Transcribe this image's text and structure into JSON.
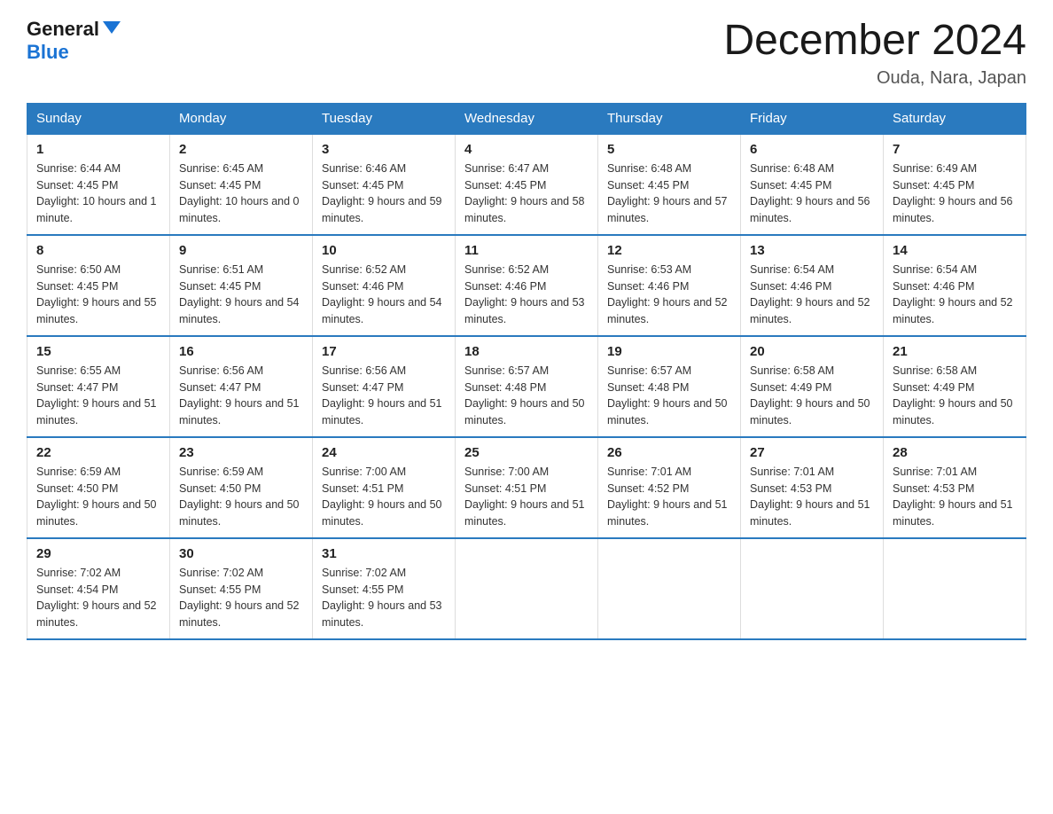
{
  "header": {
    "logo_general": "General",
    "logo_blue": "Blue",
    "month_title": "December 2024",
    "subtitle": "Ouda, Nara, Japan"
  },
  "days_of_week": [
    "Sunday",
    "Monday",
    "Tuesday",
    "Wednesday",
    "Thursday",
    "Friday",
    "Saturday"
  ],
  "weeks": [
    [
      {
        "day": "1",
        "sunrise": "6:44 AM",
        "sunset": "4:45 PM",
        "daylight": "10 hours and 1 minute."
      },
      {
        "day": "2",
        "sunrise": "6:45 AM",
        "sunset": "4:45 PM",
        "daylight": "10 hours and 0 minutes."
      },
      {
        "day": "3",
        "sunrise": "6:46 AM",
        "sunset": "4:45 PM",
        "daylight": "9 hours and 59 minutes."
      },
      {
        "day": "4",
        "sunrise": "6:47 AM",
        "sunset": "4:45 PM",
        "daylight": "9 hours and 58 minutes."
      },
      {
        "day": "5",
        "sunrise": "6:48 AM",
        "sunset": "4:45 PM",
        "daylight": "9 hours and 57 minutes."
      },
      {
        "day": "6",
        "sunrise": "6:48 AM",
        "sunset": "4:45 PM",
        "daylight": "9 hours and 56 minutes."
      },
      {
        "day": "7",
        "sunrise": "6:49 AM",
        "sunset": "4:45 PM",
        "daylight": "9 hours and 56 minutes."
      }
    ],
    [
      {
        "day": "8",
        "sunrise": "6:50 AM",
        "sunset": "4:45 PM",
        "daylight": "9 hours and 55 minutes."
      },
      {
        "day": "9",
        "sunrise": "6:51 AM",
        "sunset": "4:45 PM",
        "daylight": "9 hours and 54 minutes."
      },
      {
        "day": "10",
        "sunrise": "6:52 AM",
        "sunset": "4:46 PM",
        "daylight": "9 hours and 54 minutes."
      },
      {
        "day": "11",
        "sunrise": "6:52 AM",
        "sunset": "4:46 PM",
        "daylight": "9 hours and 53 minutes."
      },
      {
        "day": "12",
        "sunrise": "6:53 AM",
        "sunset": "4:46 PM",
        "daylight": "9 hours and 52 minutes."
      },
      {
        "day": "13",
        "sunrise": "6:54 AM",
        "sunset": "4:46 PM",
        "daylight": "9 hours and 52 minutes."
      },
      {
        "day": "14",
        "sunrise": "6:54 AM",
        "sunset": "4:46 PM",
        "daylight": "9 hours and 52 minutes."
      }
    ],
    [
      {
        "day": "15",
        "sunrise": "6:55 AM",
        "sunset": "4:47 PM",
        "daylight": "9 hours and 51 minutes."
      },
      {
        "day": "16",
        "sunrise": "6:56 AM",
        "sunset": "4:47 PM",
        "daylight": "9 hours and 51 minutes."
      },
      {
        "day": "17",
        "sunrise": "6:56 AM",
        "sunset": "4:47 PM",
        "daylight": "9 hours and 51 minutes."
      },
      {
        "day": "18",
        "sunrise": "6:57 AM",
        "sunset": "4:48 PM",
        "daylight": "9 hours and 50 minutes."
      },
      {
        "day": "19",
        "sunrise": "6:57 AM",
        "sunset": "4:48 PM",
        "daylight": "9 hours and 50 minutes."
      },
      {
        "day": "20",
        "sunrise": "6:58 AM",
        "sunset": "4:49 PM",
        "daylight": "9 hours and 50 minutes."
      },
      {
        "day": "21",
        "sunrise": "6:58 AM",
        "sunset": "4:49 PM",
        "daylight": "9 hours and 50 minutes."
      }
    ],
    [
      {
        "day": "22",
        "sunrise": "6:59 AM",
        "sunset": "4:50 PM",
        "daylight": "9 hours and 50 minutes."
      },
      {
        "day": "23",
        "sunrise": "6:59 AM",
        "sunset": "4:50 PM",
        "daylight": "9 hours and 50 minutes."
      },
      {
        "day": "24",
        "sunrise": "7:00 AM",
        "sunset": "4:51 PM",
        "daylight": "9 hours and 50 minutes."
      },
      {
        "day": "25",
        "sunrise": "7:00 AM",
        "sunset": "4:51 PM",
        "daylight": "9 hours and 51 minutes."
      },
      {
        "day": "26",
        "sunrise": "7:01 AM",
        "sunset": "4:52 PM",
        "daylight": "9 hours and 51 minutes."
      },
      {
        "day": "27",
        "sunrise": "7:01 AM",
        "sunset": "4:53 PM",
        "daylight": "9 hours and 51 minutes."
      },
      {
        "day": "28",
        "sunrise": "7:01 AM",
        "sunset": "4:53 PM",
        "daylight": "9 hours and 51 minutes."
      }
    ],
    [
      {
        "day": "29",
        "sunrise": "7:02 AM",
        "sunset": "4:54 PM",
        "daylight": "9 hours and 52 minutes."
      },
      {
        "day": "30",
        "sunrise": "7:02 AM",
        "sunset": "4:55 PM",
        "daylight": "9 hours and 52 minutes."
      },
      {
        "day": "31",
        "sunrise": "7:02 AM",
        "sunset": "4:55 PM",
        "daylight": "9 hours and 53 minutes."
      },
      null,
      null,
      null,
      null
    ]
  ]
}
